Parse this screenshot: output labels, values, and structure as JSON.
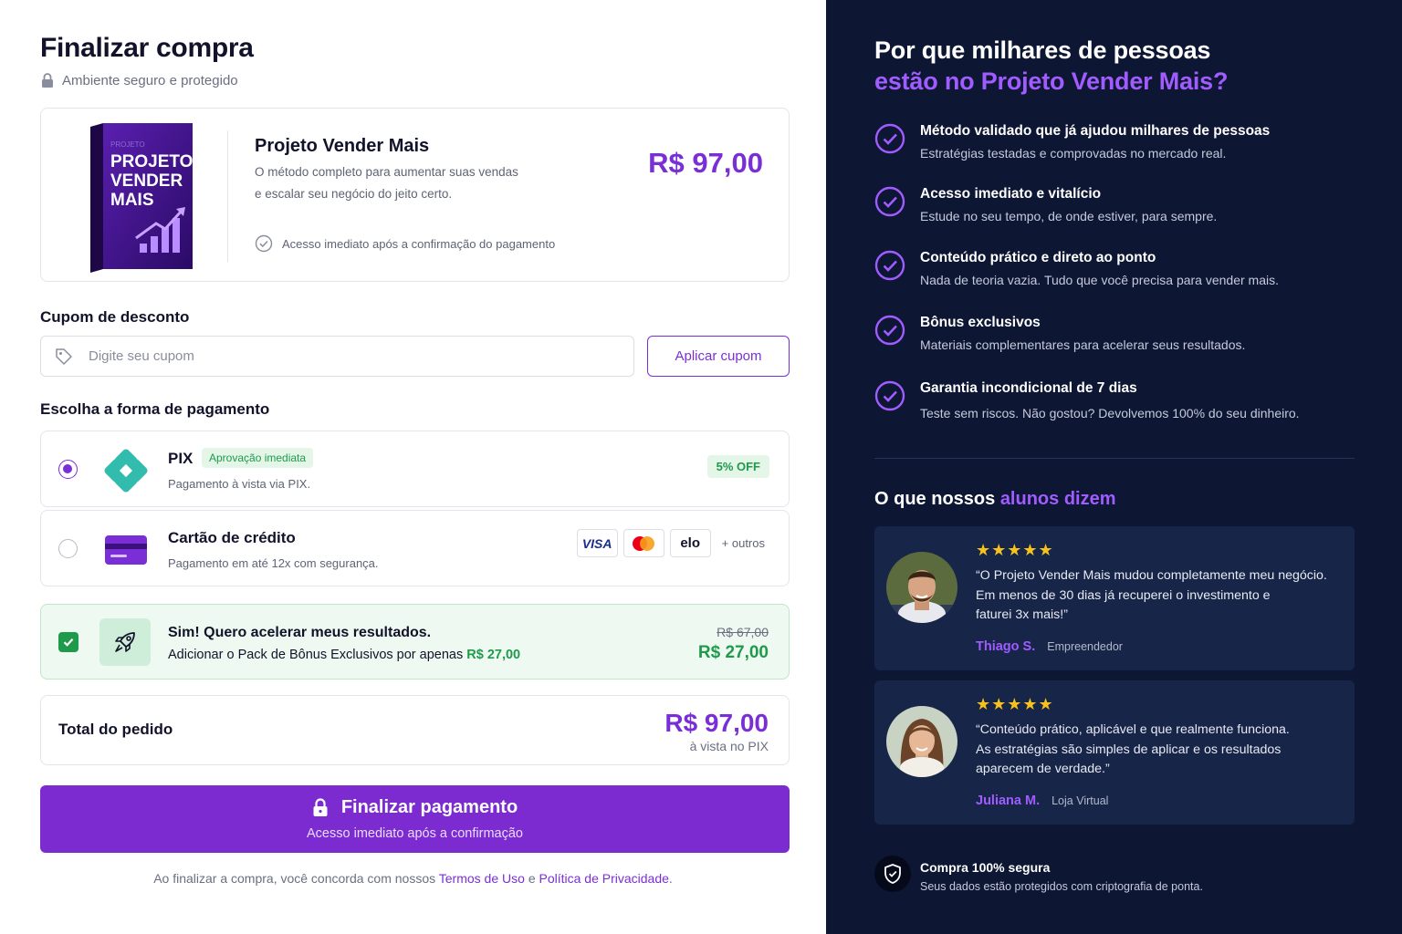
{
  "checkout": {
    "title": "Finalizar compra",
    "secure_note": "Ambiente seguro e protegido"
  },
  "product": {
    "box_text_top": "PROJETO",
    "box_text_lines": [
      "PROJETO",
      "VENDER",
      "MAIS"
    ],
    "name": "Projeto Vender Mais",
    "description_line1": "O método completo para aumentar suas vendas",
    "description_line2": "e escalar seu negócio do jeito certo.",
    "access_note": "Acesso imediato após a confirmação do pagamento",
    "price": "R$ 97,00"
  },
  "coupon": {
    "label": "Cupom de desconto",
    "placeholder": "Digite seu cupom",
    "value": "",
    "button_label": "Aplicar cupom"
  },
  "payment": {
    "label": "Escolha a forma de pagamento",
    "selected": "pix",
    "options": [
      {
        "id": "pix",
        "name": "PIX",
        "badge": "Aprovação imediata",
        "subtitle": "Pagamento à vista via PIX.",
        "discount": "5% OFF"
      },
      {
        "id": "card",
        "name": "Cartão de crédito",
        "subtitle": "Pagamento em até 12x com segurança.",
        "brands": [
          "VISA",
          "Mastercard",
          "elo"
        ],
        "more": "+ outros"
      }
    ]
  },
  "bonus": {
    "checked": true,
    "title": "Sim! Quero acelerar meus resultados.",
    "subtitle": "Adicionar o Pack de Bônus Exclusivos por apenas",
    "subtitle_price": "R$ 27,00",
    "old_price": "R$ 67,00",
    "price": "R$ 27,00"
  },
  "total": {
    "label": "Total do pedido",
    "price": "R$ 97,00",
    "note": "à vista no PIX"
  },
  "finish": {
    "label": "Finalizar pagamento",
    "sublabel": "Acesso imediato após a confirmação"
  },
  "terms": {
    "prefix": "Ao finalizar a compra, você concorda com nossos",
    "terms_link": "Termos de Uso",
    "and": "e",
    "privacy_link": "Política de Privacidade",
    "suffix": "."
  },
  "why": {
    "title_line1": "Por que milhares de pessoas",
    "title_line2": "estão no Projeto Vender Mais?",
    "features": [
      {
        "title": "Método validado que já ajudou milhares de pessoas",
        "subtitle": "Estratégias testadas e comprovadas no mercado real."
      },
      {
        "title": "Acesso imediato e vitalício",
        "subtitle": "Estude no seu tempo, de onde estiver, para sempre."
      },
      {
        "title": "Conteúdo prático e direto ao ponto",
        "subtitle": "Nada de teoria vazia. Tudo que você precisa para vender mais."
      },
      {
        "title": "Bônus exclusivos",
        "subtitle": "Materiais complementares para acelerar seus resultados."
      },
      {
        "title": "Garantia incondicional de 7 dias",
        "subtitle": "Teste sem riscos. Não gostou? Devolvemos 100% do seu dinheiro."
      }
    ]
  },
  "testimonials": {
    "heading_plain": "O que nossos",
    "heading_accent": "alunos dizem",
    "items": [
      {
        "stars": "★★★★★",
        "rating": 5,
        "quote_line1": "“O Projeto Vender Mais mudou completamente meu negócio.",
        "quote_line2": "Em menos de 30 dias já recuperei o investimento e",
        "quote_line3": "faturei 3x mais!”",
        "name": "Thiago S.",
        "role": "Empreendedor"
      },
      {
        "stars": "★★★★★",
        "rating": 5,
        "quote_line1": "“Conteúdo prático, aplicável e que realmente funciona.",
        "quote_line2": "As estratégias são simples de aplicar e os resultados",
        "quote_line3": "aparecem de verdade.”",
        "name": "Juliana M.",
        "role": "Loja Virtual"
      }
    ]
  },
  "security": {
    "title": "Compra 100% segura",
    "subtitle": "Seus dados estão protegidos com criptografia de ponta."
  },
  "colors": {
    "accent": "#7a2fd6",
    "accent_light": "#a05cff",
    "success": "#1f9a4b",
    "panel_dark": "#0d1633",
    "star": "#f7c21b"
  }
}
